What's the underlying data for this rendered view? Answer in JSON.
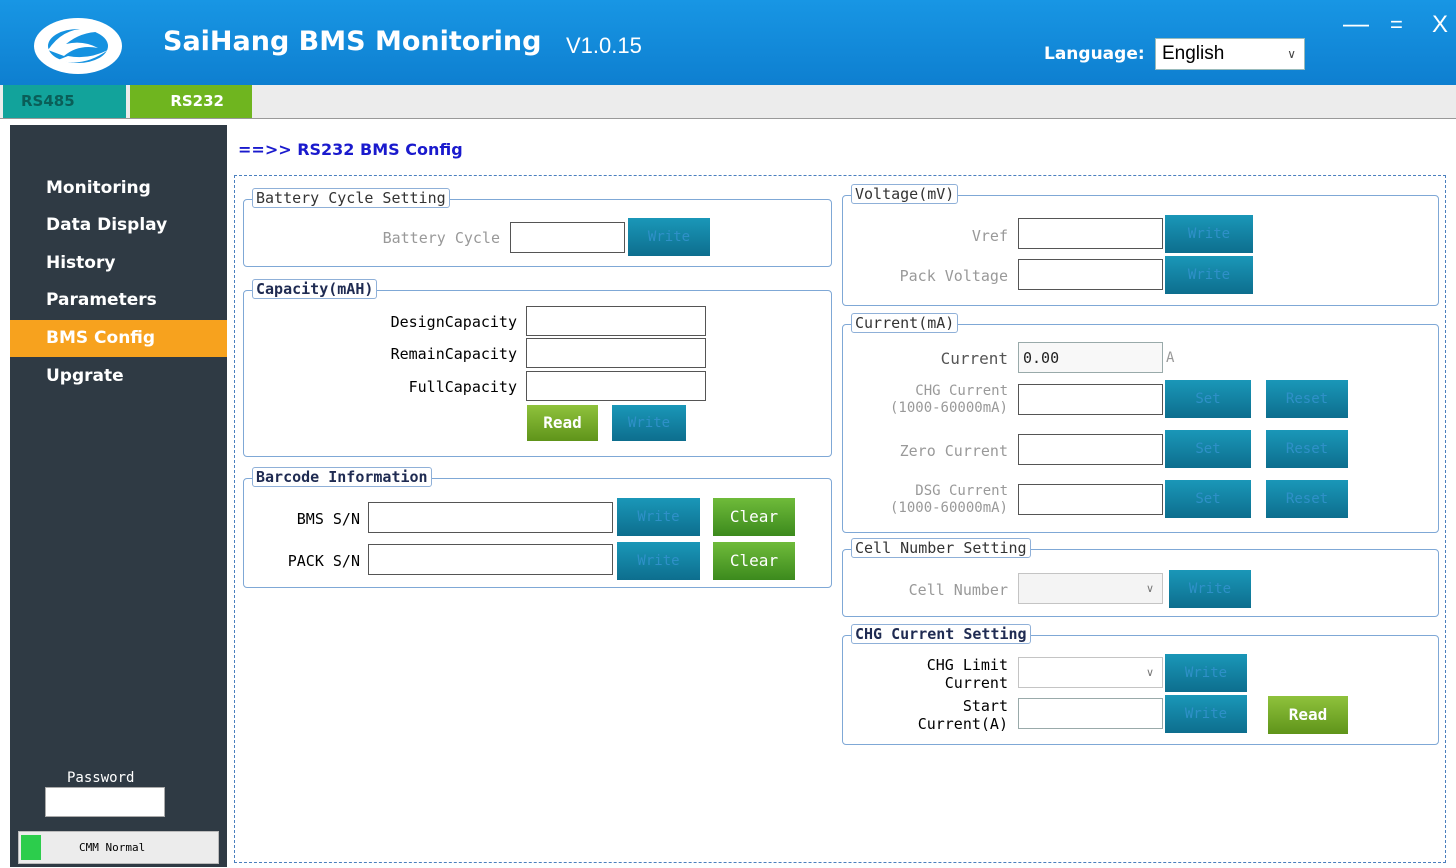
{
  "header": {
    "title": "SaiHang BMS Monitoring",
    "version": "V1.0.15",
    "language_label": "Language:",
    "language_value": "English",
    "minimize": "—",
    "maximize": "=",
    "close": "X"
  },
  "tabs": [
    {
      "label": "RS485"
    },
    {
      "label": "RS232"
    }
  ],
  "sidebar": {
    "items": [
      {
        "label": "Monitoring"
      },
      {
        "label": "Data Display"
      },
      {
        "label": "History"
      },
      {
        "label": "Parameters"
      },
      {
        "label": "BMS Config"
      },
      {
        "label": "Upgrate"
      }
    ],
    "active": "BMS Config",
    "password_label": "Password",
    "password_value": "",
    "status": "CMM Normal"
  },
  "breadcrumb": "==>> RS232 BMS Config",
  "battery_cycle": {
    "title": "Battery Cycle Setting",
    "label": "Battery Cycle",
    "value": "",
    "write": "Write"
  },
  "capacity": {
    "title": "Capacity(mAH)",
    "design_label": "DesignCapacity",
    "remain_label": "RemainCapacity",
    "full_label": "FullCapacity",
    "read": "Read",
    "write": "Write"
  },
  "barcode": {
    "title": "Barcode Information",
    "bms_label": "BMS S/N",
    "pack_label": "PACK S/N",
    "write": "Write",
    "clear": "Clear"
  },
  "voltage": {
    "title": "Voltage(mV)",
    "vref_label": "Vref",
    "pack_label": "Pack Voltage",
    "write": "Write"
  },
  "current": {
    "title": "Current(mA)",
    "current_label": "Current",
    "current_value": "0.00",
    "unit": "A",
    "chg_label": "CHG Current",
    "chg_range": "(1000-60000mA)",
    "zero_label": "Zero Current",
    "dsg_label": "DSG Current",
    "dsg_range": "(1000-60000mA)",
    "set": "Set",
    "reset": "Reset"
  },
  "cell_number": {
    "title": "Cell Number Setting",
    "label": "Cell Number",
    "value": "",
    "write": "Write"
  },
  "chg_setting": {
    "title": "CHG Current Setting",
    "limit_label_1": "CHG Limit",
    "limit_label_2": "Current",
    "start_label_1": "Start",
    "start_label_2": "Current(A)",
    "write": "Write",
    "read": "Read"
  },
  "colors": {
    "header_blue": "#1592e0",
    "sidebar_bg": "#2f3a44",
    "active_nav": "#f7a21e",
    "tab_rs485": "#12a39b",
    "tab_rs232": "#6fb51f",
    "teal_button": "#1589aa",
    "green_button": "#6fa826",
    "status_led": "#2ccd4c"
  }
}
